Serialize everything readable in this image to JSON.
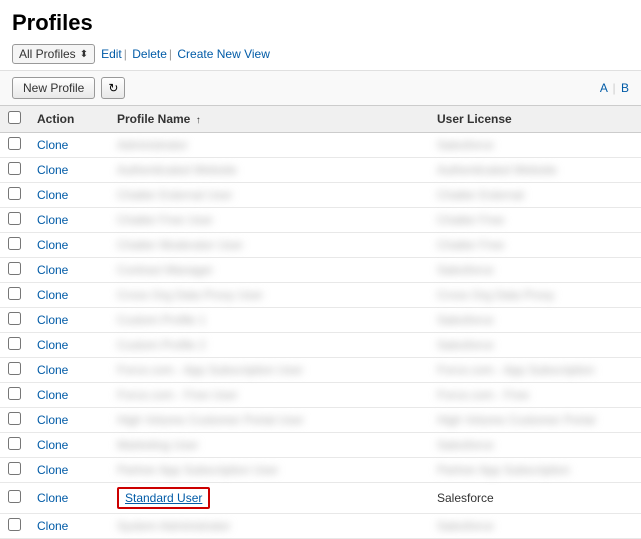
{
  "page": {
    "title": "Profiles",
    "view_selector": {
      "label": "All Profiles",
      "options": [
        "All Profiles"
      ]
    },
    "view_links": {
      "edit": "Edit",
      "delete": "Delete",
      "create_new_view": "Create New View"
    },
    "toolbar": {
      "new_profile_label": "New Profile",
      "refresh_icon": "↻",
      "alpha_a": "A",
      "alpha_b": "B"
    },
    "table": {
      "columns": [
        {
          "key": "action",
          "label": "Action"
        },
        {
          "key": "name",
          "label": "Profile Name",
          "sort": "↑"
        },
        {
          "key": "license",
          "label": "User License"
        }
      ],
      "rows": [
        {
          "action": "Clone",
          "name": "blurred_1",
          "license": "blurred",
          "blurred": true
        },
        {
          "action": "Clone",
          "name": "blurred_2",
          "license": "blurred",
          "blurred": true
        },
        {
          "action": "Clone",
          "name": "blurred_3",
          "license": "blurred",
          "blurred": true
        },
        {
          "action": "Clone",
          "name": "blurred_4",
          "license": "blurred",
          "blurred": true
        },
        {
          "action": "Clone",
          "name": "blurred_5",
          "license": "blurred",
          "blurred": true
        },
        {
          "action": "Clone",
          "name": "blurred_6",
          "license": "blurred",
          "blurred": true
        },
        {
          "action": "Clone",
          "name": "blurred_7",
          "license": "blurred",
          "blurred": true
        },
        {
          "action": "Clone",
          "name": "blurred_8",
          "license": "blurred",
          "blurred": true
        },
        {
          "action": "Clone",
          "name": "blurred_9",
          "license": "blurred",
          "blurred": true
        },
        {
          "action": "Clone",
          "name": "blurred_10",
          "license": "blurred",
          "blurred": true
        },
        {
          "action": "Clone",
          "name": "blurred_11",
          "license": "blurred",
          "blurred": true
        },
        {
          "action": "Clone",
          "name": "blurred_12",
          "license": "blurred",
          "blurred": true
        },
        {
          "action": "Clone",
          "name": "blurred_13",
          "license": "blurred",
          "blurred": true
        },
        {
          "action": "Clone",
          "name": "blurred_14",
          "license": "blurred",
          "blurred": true
        },
        {
          "action": "Clone",
          "name": "Standard User",
          "license": "Salesforce",
          "blurred": false,
          "highlighted": true
        },
        {
          "action": "Clone",
          "name": "blurred_16",
          "license": "blurred",
          "blurred": true
        }
      ],
      "clone_label": "Clone"
    }
  }
}
